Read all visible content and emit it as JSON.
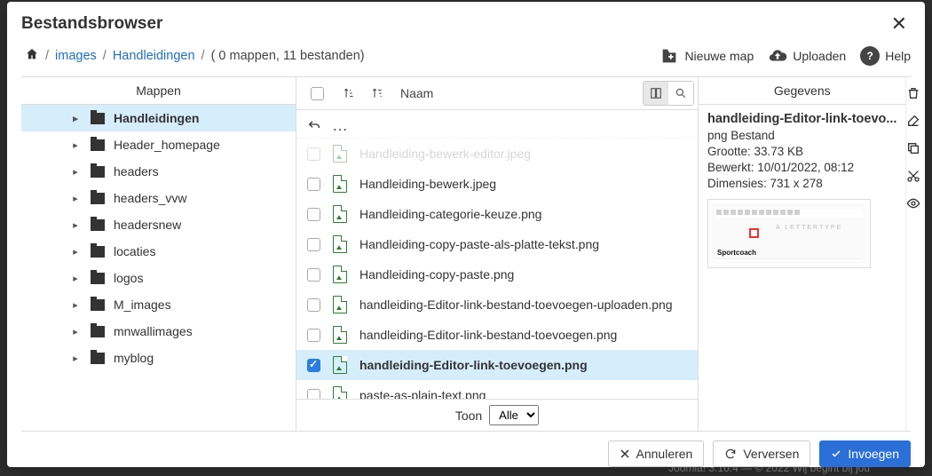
{
  "title": "Bestandsbrowser",
  "breadcrumb": {
    "images": "images",
    "folder": "Handleidingen",
    "stats": "( 0 mappen, 11 bestanden)"
  },
  "toolbar": {
    "new_folder": "Nieuwe map",
    "upload": "Uploaden",
    "help": "Help"
  },
  "panels": {
    "folders_header": "Mappen",
    "details_header": "Gegevens",
    "name_header": "Naam"
  },
  "folders": [
    {
      "label": "Handleidingen",
      "selected": true
    },
    {
      "label": "Header_homepage"
    },
    {
      "label": "headers"
    },
    {
      "label": "headers_vvw"
    },
    {
      "label": "headersnew"
    },
    {
      "label": "locaties"
    },
    {
      "label": "logos"
    },
    {
      "label": "M_images"
    },
    {
      "label": "mnwallimages"
    },
    {
      "label": "myblog"
    }
  ],
  "files_cut": "Handleiding-bewerk-editor.jpeg",
  "files": [
    {
      "name": "Handleiding-bewerk.jpeg"
    },
    {
      "name": "Handleiding-categorie-keuze.png"
    },
    {
      "name": "Handleiding-copy-paste-als-platte-tekst.png"
    },
    {
      "name": "Handleiding-copy-paste.png"
    },
    {
      "name": "handleiding-Editor-link-bestand-toevoegen-uploaden.png"
    },
    {
      "name": "handleiding-Editor-link-bestand-toevoegen.png"
    },
    {
      "name": "handleiding-Editor-link-toevoegen.png",
      "selected": true
    },
    {
      "name": "paste-as-plain-text.png"
    }
  ],
  "footer_filter": {
    "label": "Toon",
    "value": "Alle"
  },
  "details": {
    "title": "handleiding-Editor-link-toevo...",
    "type": "png Bestand",
    "size_label": "Grootte: 33.73 KB",
    "modified_label": "Bewerkt: 10/01/2022, 08:12",
    "dim_label": "Dimensies: 731 x 278",
    "thumb_caption": "Sportcoach"
  },
  "buttons": {
    "cancel": "Annuleren",
    "refresh": "Verversen",
    "insert": "Invoegen"
  },
  "backdrop": "Joomla! 3.10.4  —  © 2022 Wij begint bij jou"
}
